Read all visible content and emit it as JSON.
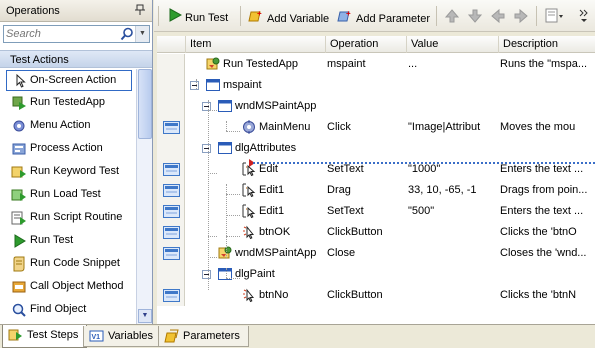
{
  "left_panel": {
    "title": "Operations",
    "search_placeholder": "Search",
    "section_title": "Test Actions",
    "actions": [
      {
        "label": "On-Screen Action",
        "icon": "on-screen-action-icon",
        "selected": true
      },
      {
        "label": "Run TestedApp",
        "icon": "run-testedapp-icon"
      },
      {
        "label": "Menu Action",
        "icon": "menu-action-icon"
      },
      {
        "label": "Process Action",
        "icon": "process-action-icon"
      },
      {
        "label": "Run Keyword Test",
        "icon": "run-keyword-test-icon"
      },
      {
        "label": "Run Load Test",
        "icon": "run-load-test-icon"
      },
      {
        "label": "Run Script Routine",
        "icon": "run-script-routine-icon"
      },
      {
        "label": "Run Test",
        "icon": "run-test-icon"
      },
      {
        "label": "Run Code Snippet",
        "icon": "run-code-snippet-icon"
      },
      {
        "label": "Call Object Method",
        "icon": "call-object-method-icon"
      },
      {
        "label": "Find Object",
        "icon": "find-object-icon"
      }
    ]
  },
  "toolbar": {
    "run_test": "Run Test",
    "add_variable": "Add Variable",
    "add_parameter": "Add Parameter"
  },
  "grid": {
    "columns": [
      "Item",
      "Operation",
      "Value",
      "Description"
    ],
    "rows": [
      {
        "item": "Run TestedApp",
        "operation": "mspaint",
        "value": "...",
        "description": "Runs the \"mspa...",
        "level": 1,
        "icon": "tested-app-icon",
        "gutter": false
      },
      {
        "item": "mspaint",
        "operation": "",
        "value": "",
        "description": "",
        "level": 1,
        "icon": "window-icon",
        "gutter": false,
        "expander": true
      },
      {
        "item": "wndMSPaintApp",
        "operation": "",
        "value": "",
        "description": "",
        "level": 2,
        "icon": "window-icon",
        "gutter": false,
        "expander": true
      },
      {
        "item": "MainMenu",
        "operation": "Click",
        "value": "\"Image|Attribut",
        "description": "Moves the mou",
        "level": 3,
        "icon": "menu-item-icon",
        "gutter": true
      },
      {
        "item": "dlgAttributes",
        "operation": "",
        "value": "",
        "description": "",
        "level": 2,
        "icon": "window-icon",
        "gutter": false,
        "expander": true
      },
      {
        "item": "Edit",
        "operation": "SetText",
        "value": "\"1000\"",
        "description": "Enters the text ...",
        "level": 3,
        "icon": "edit-control-icon",
        "gutter": true
      },
      {
        "item": "Edit1",
        "operation": "Drag",
        "value": "33, 10, -65, -1",
        "description": "Drags from poin...",
        "level": 3,
        "icon": "edit-control-icon",
        "gutter": true
      },
      {
        "item": "Edit1",
        "operation": "SetText",
        "value": "\"500\"",
        "description": "Enters the text ...",
        "level": 3,
        "icon": "edit-control-icon",
        "gutter": true
      },
      {
        "item": "btnOK",
        "operation": "ClickButton",
        "value": "",
        "description": "Clicks the 'btnO",
        "level": 3,
        "icon": "button-control-icon",
        "gutter": true
      },
      {
        "item": "wndMSPaintApp",
        "operation": "Close",
        "value": "",
        "description": "Closes the 'wnd...",
        "level": 2,
        "icon": "tested-app-icon",
        "gutter": true
      },
      {
        "item": "dlgPaint",
        "operation": "",
        "value": "",
        "description": "",
        "level": 2,
        "icon": "window-icon",
        "gutter": false,
        "expander": true
      },
      {
        "item": "btnNo",
        "operation": "ClickButton",
        "value": "",
        "description": "Clicks the 'btnN",
        "level": 3,
        "icon": "button-control-icon",
        "gutter": true
      }
    ]
  },
  "tabs": [
    {
      "label": "Test Steps",
      "active": true,
      "icon": "test-steps-icon"
    },
    {
      "label": "Variables",
      "active": false,
      "icon": "variables-icon"
    },
    {
      "label": "Parameters",
      "active": false,
      "icon": "parameters-icon"
    }
  ]
}
